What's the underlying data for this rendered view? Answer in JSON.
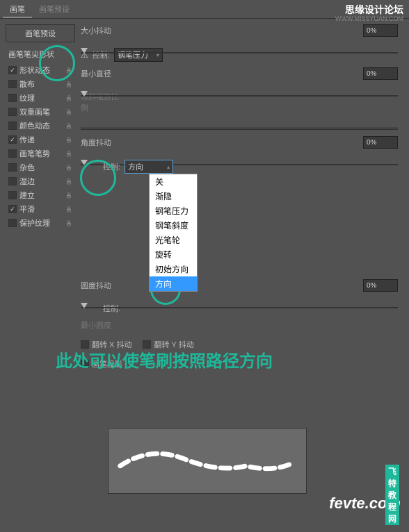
{
  "watermark": {
    "title": "思缘设计论坛",
    "url": "WWW.MISSYUAN.COM"
  },
  "tabs": {
    "brush": "画笔",
    "preset": "画笔预设"
  },
  "preset_button": "画笔预设",
  "sidebar": {
    "tip_shape": "画笔笔尖形状",
    "items": [
      {
        "label": "形状动态",
        "checked": true,
        "locked": true
      },
      {
        "label": "散布",
        "checked": false,
        "locked": true
      },
      {
        "label": "纹理",
        "checked": false,
        "locked": true
      },
      {
        "label": "双重画笔",
        "checked": false,
        "locked": true
      },
      {
        "label": "颜色动态",
        "checked": false,
        "locked": true
      },
      {
        "label": "传递",
        "checked": true,
        "locked": true
      },
      {
        "label": "画笔笔势",
        "checked": false,
        "locked": true
      },
      {
        "label": "杂色",
        "checked": false,
        "locked": true
      },
      {
        "label": "湿边",
        "checked": false,
        "locked": true
      },
      {
        "label": "建立",
        "checked": false,
        "locked": true
      },
      {
        "label": "平滑",
        "checked": true,
        "locked": true
      },
      {
        "label": "保护纹理",
        "checked": false,
        "locked": true
      }
    ]
  },
  "content": {
    "size_jitter": {
      "label": "大小抖动",
      "value": "0%"
    },
    "control1": {
      "label": "控制:",
      "value": "钢笔压力",
      "warn": "⚠"
    },
    "min_diameter": {
      "label": "最小直径",
      "value": "0%"
    },
    "tilt_scale": {
      "label": "倾斜缩放比例"
    },
    "angle_jitter": {
      "label": "角度抖动",
      "value": "0%"
    },
    "control2": {
      "label": "控制:",
      "value": "方向"
    },
    "dropdown_options": [
      "关",
      "渐隐",
      "钢笔压力",
      "钢笔斜度",
      "光笔轮",
      "旋转",
      "初始方向",
      "方向"
    ],
    "roundness_jitter": {
      "label": "圆度抖动",
      "value": "0%"
    },
    "control3": {
      "label": "控制:"
    },
    "min_roundness": {
      "label": "最小圆度"
    },
    "flip_x": "翻转 X 抖动",
    "flip_y": "翻转 Y 抖动",
    "brush_projection": "画笔投影"
  },
  "annotation": "此处可以使笔刷按照路径方向",
  "logo": {
    "main": "fevte.com",
    "sub": "飞特教程网"
  }
}
